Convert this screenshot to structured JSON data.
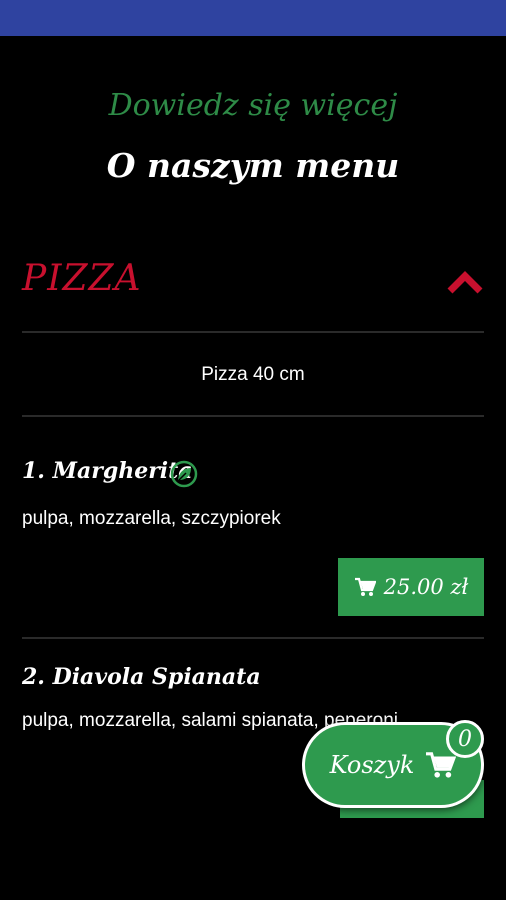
{
  "header": {
    "subtitle": "Dowiedz się więcej",
    "title": "O naszym menu"
  },
  "section": {
    "title": "PIZZA",
    "size_label": "Pizza 40 cm"
  },
  "items": [
    {
      "name": "1. Margherita",
      "desc": "pulpa, mozzarella, szczypiorek",
      "price": "25.00 zł",
      "vegetarian": true
    },
    {
      "name": "2. Diavola Spianata",
      "desc": "pulpa, mozzarella, salami spianata, peperoni"
    }
  ],
  "cart": {
    "label": "Koszyk",
    "count": "0"
  },
  "colors": {
    "status_bar": "#2f43a0",
    "accent_green": "#2e9a4e",
    "accent_red": "#c8102e",
    "background": "#000000"
  },
  "icons": [
    "chevron-up-icon",
    "leaf-icon",
    "cart-icon"
  ]
}
